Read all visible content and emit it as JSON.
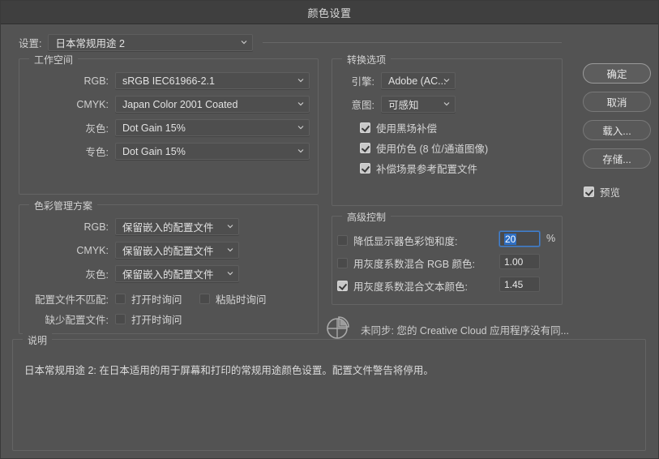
{
  "window": {
    "title": "颜色设置"
  },
  "settings": {
    "label": "设置:",
    "value": "日本常规用途 2"
  },
  "working_spaces": {
    "group_label": "工作空间",
    "rows": [
      {
        "label": "RGB:",
        "value": "sRGB IEC61966-2.1"
      },
      {
        "label": "CMYK:",
        "value": "Japan Color 2001 Coated"
      },
      {
        "label": "灰色:",
        "value": "Dot Gain 15%"
      },
      {
        "label": "专色:",
        "value": "Dot Gain 15%"
      }
    ]
  },
  "color_management": {
    "group_label": "色彩管理方案",
    "rows": [
      {
        "label": "RGB:",
        "value": "保留嵌入的配置文件"
      },
      {
        "label": "CMYK:",
        "value": "保留嵌入的配置文件"
      },
      {
        "label": "灰色:",
        "value": "保留嵌入的配置文件"
      }
    ],
    "mismatch_label": "配置文件不匹配:",
    "mismatch_open": {
      "text": "打开时询问",
      "checked": false
    },
    "mismatch_paste": {
      "text": "粘贴时询问",
      "checked": false
    },
    "missing_label": "缺少配置文件:",
    "missing_open": {
      "text": "打开时询问",
      "checked": false
    }
  },
  "conversion": {
    "group_label": "转换选项",
    "engine_label": "引擎:",
    "engine_value": "Adobe (AC...",
    "intent_label": "意图:",
    "intent_value": "可感知",
    "options": [
      {
        "text": "使用黑场补偿",
        "checked": true
      },
      {
        "text": "使用仿色 (8 位/通道图像)",
        "checked": true
      },
      {
        "text": "补偿场景参考配置文件",
        "checked": true
      }
    ]
  },
  "advanced": {
    "group_label": "高级控制",
    "rows": [
      {
        "text": "降低显示器色彩饱和度:",
        "checked": false,
        "value": "20",
        "suffix": "%",
        "focused": true
      },
      {
        "text": "用灰度系数混合 RGB 颜色:",
        "checked": false,
        "value": "1.00",
        "suffix": "",
        "focused": false
      },
      {
        "text": "用灰度系数混合文本颜色:",
        "checked": true,
        "value": "1.45",
        "suffix": "",
        "focused": false
      }
    ]
  },
  "sync_status": {
    "icon": "creative-cloud-sync-icon",
    "text": "未同步: 您的 Creative Cloud 应用程序没有同..."
  },
  "description": {
    "group_label": "说明",
    "text": "日本常规用途 2: 在日本适用的用于屏幕和打印的常规用途颜色设置。配置文件警告将停用。"
  },
  "buttons": {
    "ok": "确定",
    "cancel": "取消",
    "load": "载入...",
    "save": "存储...",
    "preview": {
      "label": "预览",
      "checked": true
    }
  },
  "colors": {
    "dialog_bg": "#535353",
    "titlebar_bg": "#3f3f3f",
    "field_bg": "#4e4e4e",
    "accent_selection": "#2e6fc4",
    "text": "#d8d8d8"
  }
}
